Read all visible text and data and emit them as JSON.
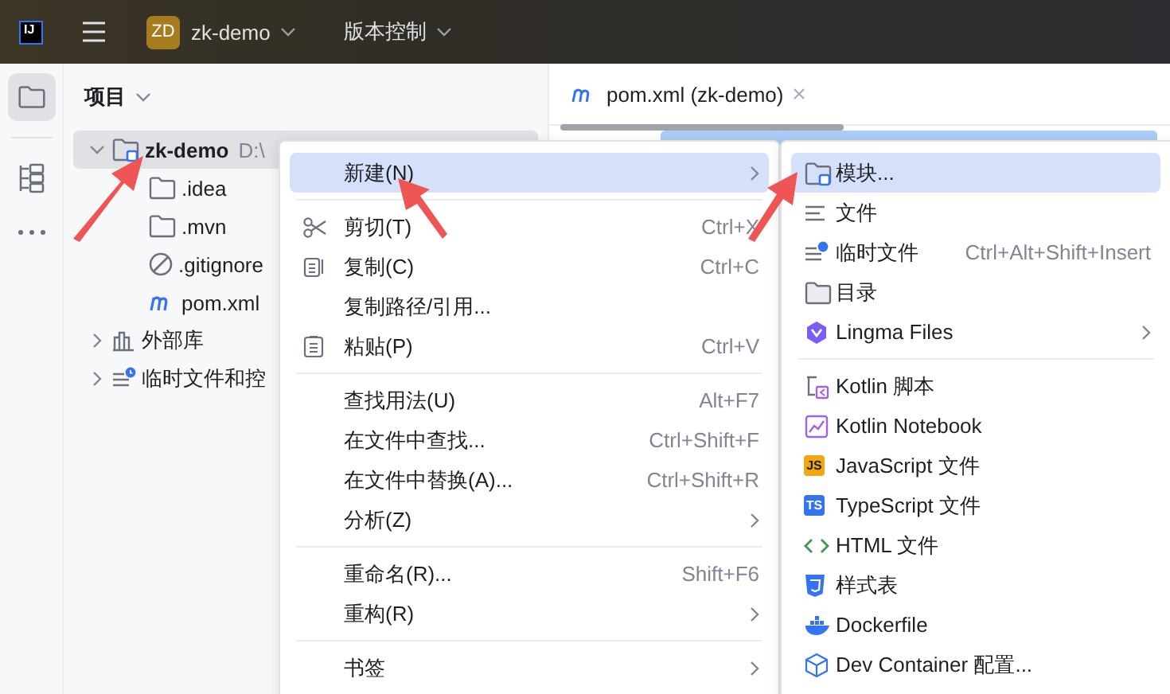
{
  "toolbar": {
    "logo": "IJ",
    "project_badge": "ZD",
    "project": "zk-demo",
    "vcs": "版本控制"
  },
  "tool_strip": [
    {
      "selected": true
    },
    {
      "selected": false
    },
    {
      "selected": false
    }
  ],
  "project_panel": {
    "title": "项目",
    "tree": [
      {
        "label": "zk-demo",
        "path": "D:\\",
        "expanded": true,
        "selected": true,
        "children": [
          {
            "label": ".idea"
          },
          {
            "label": ".mvn"
          },
          {
            "label": ".gitignore"
          },
          {
            "label": "pom.xml"
          }
        ]
      },
      {
        "label": "外部库",
        "expanded": false,
        "selected": false
      },
      {
        "label": "临时文件和控",
        "expanded": false,
        "selected": false
      }
    ]
  },
  "editor_tab": {
    "label": "pom.xml (zk-demo)"
  },
  "context_menu": {
    "items": [
      {
        "kind": "item",
        "label": "新建(N)",
        "submenu": true,
        "selected": true
      },
      {
        "kind": "separator"
      },
      {
        "kind": "item",
        "label": "剪切(T)",
        "shortcut": "Ctrl+X",
        "selected": false
      },
      {
        "kind": "item",
        "label": "复制(C)",
        "shortcut": "Ctrl+C",
        "selected": false
      },
      {
        "kind": "item",
        "label": "复制路径/引用...",
        "selected": false
      },
      {
        "kind": "item",
        "label": "粘贴(P)",
        "shortcut": "Ctrl+V",
        "selected": false
      },
      {
        "kind": "separator"
      },
      {
        "kind": "item",
        "label": "查找用法(U)",
        "shortcut": "Alt+F7",
        "selected": false
      },
      {
        "kind": "item",
        "label": "在文件中查找...",
        "shortcut": "Ctrl+Shift+F",
        "selected": false
      },
      {
        "kind": "item",
        "label": "在文件中替换(A)...",
        "shortcut": "Ctrl+Shift+R",
        "selected": false
      },
      {
        "kind": "item",
        "label": "分析(Z)",
        "submenu": true,
        "selected": false
      },
      {
        "kind": "separator"
      },
      {
        "kind": "item",
        "label": "重命名(R)...",
        "shortcut": "Shift+F6",
        "selected": false
      },
      {
        "kind": "item",
        "label": "重构(R)",
        "submenu": true,
        "selected": false
      },
      {
        "kind": "separator"
      },
      {
        "kind": "item",
        "label": "书签",
        "submenu": true,
        "selected": false
      }
    ]
  },
  "submenu": {
    "items": [
      {
        "kind": "item",
        "label": "模块...",
        "selected": true
      },
      {
        "kind": "item",
        "label": "文件",
        "selected": false
      },
      {
        "kind": "item",
        "label": "临时文件",
        "shortcut": "Ctrl+Alt+Shift+Insert",
        "selected": false
      },
      {
        "kind": "item",
        "label": "目录",
        "selected": false
      },
      {
        "kind": "item",
        "label": "Lingma Files",
        "submenu": true,
        "selected": false
      },
      {
        "kind": "separator"
      },
      {
        "kind": "item",
        "label": "Kotlin 脚本",
        "selected": false
      },
      {
        "kind": "item",
        "label": "Kotlin Notebook",
        "selected": false
      },
      {
        "kind": "item",
        "label": "JavaScript 文件",
        "badge": "JS",
        "selected": false
      },
      {
        "kind": "item",
        "label": "TypeScript 文件",
        "badge": "TS",
        "selected": false
      },
      {
        "kind": "item",
        "label": "HTML 文件",
        "selected": false
      },
      {
        "kind": "item",
        "label": "样式表",
        "selected": false
      },
      {
        "kind": "item",
        "label": "Dockerfile",
        "selected": false
      },
      {
        "kind": "item",
        "label": "Dev Container 配置...",
        "selected": false
      }
    ]
  }
}
